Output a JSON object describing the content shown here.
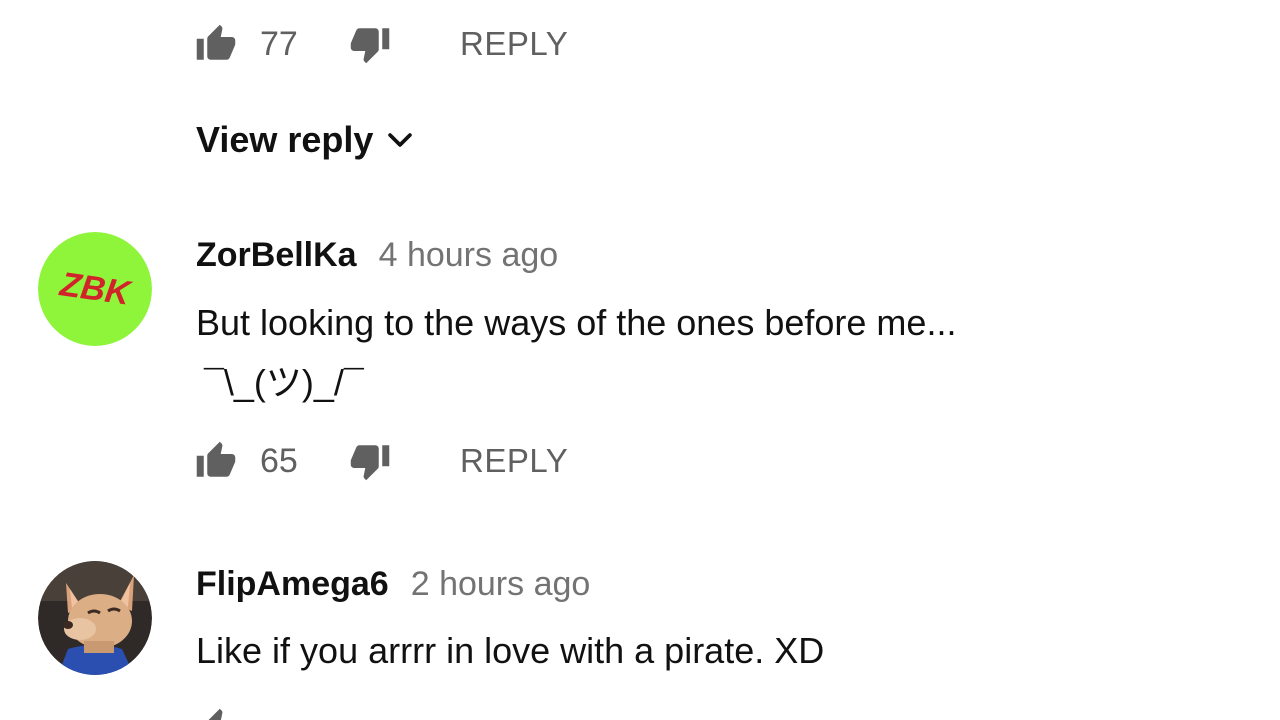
{
  "top_actions": {
    "like_count": "77",
    "reply_label": "REPLY"
  },
  "view_reply": {
    "label": "View reply"
  },
  "comments": [
    {
      "author": "ZorBellKa",
      "timestamp": "4 hours ago",
      "text_line1": "But looking to the ways of the ones before me...",
      "text_line2": "¯\\_(ツ)_/¯",
      "like_count": "65",
      "reply_label": "REPLY",
      "avatar_text": "ZBK",
      "avatar_bg": "#8ef53a",
      "avatar_text_color": "#d1232a"
    },
    {
      "author": "FlipAmega6",
      "timestamp": "2 hours ago",
      "text_line1": "Like if you arrrr in love with a pirate. XD",
      "avatar_desc": "dog-photo"
    }
  ],
  "colors": {
    "secondary_text": "#606060",
    "timestamp_text": "#737373",
    "primary_text": "#111111"
  }
}
